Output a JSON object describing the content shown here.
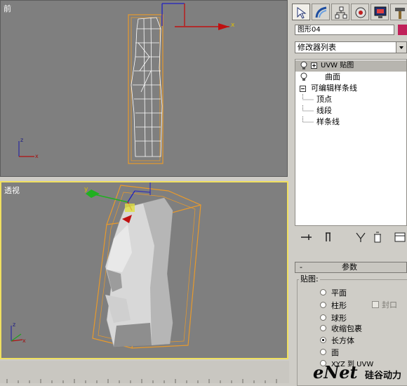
{
  "viewports": {
    "front": {
      "label": "前"
    },
    "perspective": {
      "label": "透视"
    }
  },
  "axes": {
    "x": "x",
    "y": "y",
    "z": "z"
  },
  "command_panel": {
    "tabs": [
      "create-tab",
      "modify-tab",
      "hierarchy-tab",
      "motion-tab",
      "display-tab",
      "utilities-tab"
    ],
    "object_name": "图形04",
    "object_color": "#c0215a",
    "modifier_list": "修改器列表",
    "stack": [
      {
        "label": "UVW 贴图",
        "selected": true
      },
      {
        "label": "曲面"
      },
      {
        "label": "可编辑样条线"
      },
      {
        "label": "顶点"
      },
      {
        "label": "线段"
      },
      {
        "label": "样条线"
      }
    ],
    "rollout": {
      "title": "参数",
      "group_title": "贴图:",
      "options": [
        "平面",
        "柱形",
        "球形",
        "收缩包裹",
        "长方体",
        "面",
        "XYZ 到 UVW"
      ],
      "selected": "长方体",
      "cap_label": "封口"
    }
  },
  "watermark": {
    "brand": "eNet",
    "suffix": "硅谷动力"
  }
}
